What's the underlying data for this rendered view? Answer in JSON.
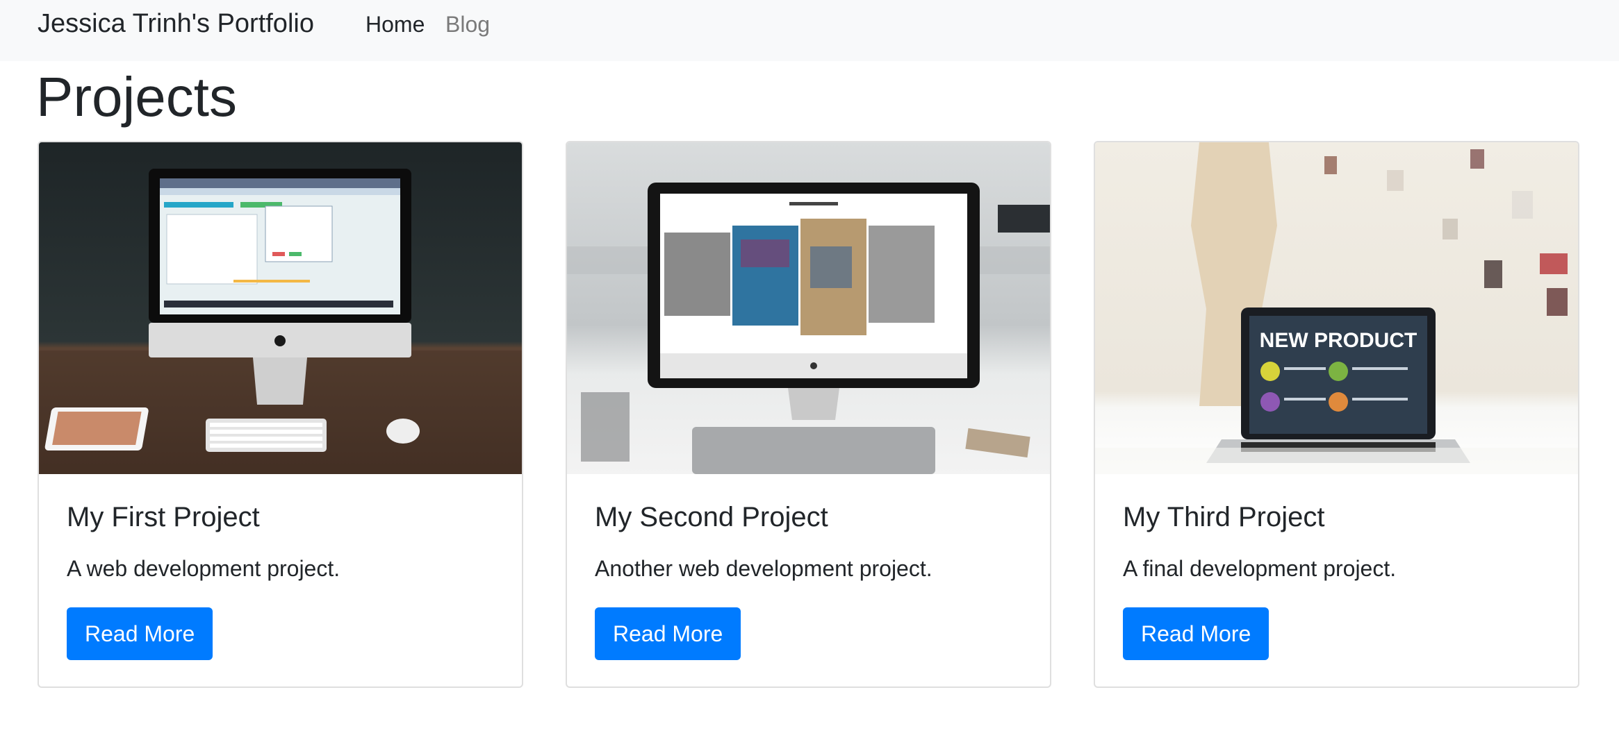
{
  "navbar": {
    "brand": "Jessica Trinh's Portfolio",
    "links": [
      {
        "label": "Home",
        "active": true
      },
      {
        "label": "Blog",
        "active": false
      }
    ]
  },
  "page": {
    "title": "Projects"
  },
  "cards": [
    {
      "title": "My First Project",
      "text": "A web development project.",
      "button_label": "Read More",
      "image": "desktop-computer-on-desk-photo"
    },
    {
      "title": "My Second Project",
      "text": "Another web development project.",
      "button_label": "Read More",
      "image": "monitor-with-gallery-website-photo"
    },
    {
      "title": "My Third Project",
      "text": "A final development project.",
      "button_label": "Read More",
      "image": "laptop-new-product-presentation-photo",
      "image_text": "NEW PRODUCT"
    }
  ],
  "colors": {
    "navbar_bg": "#f8f9fa",
    "brand_text": "#212529",
    "inactive_link": "#7a7a7a",
    "button_bg": "#007bff",
    "button_text": "#ffffff",
    "card_border": "#dfdfdf"
  }
}
